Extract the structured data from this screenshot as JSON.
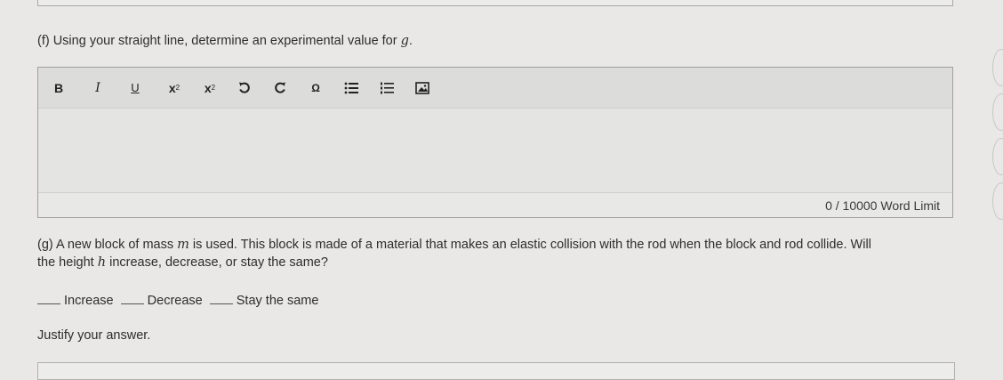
{
  "question_f": {
    "text_before": "(f) Using your straight line, determine an experimental value for ",
    "var": "g",
    "text_after": "."
  },
  "toolbar": {
    "bold": "B",
    "italic": "I",
    "underline": "U",
    "superscript_base": "x",
    "superscript_exp": "2",
    "subscript_base": "x",
    "subscript_index": "2",
    "omega": "Ω"
  },
  "editor": {
    "word_limit": "0 / 10000 Word Limit"
  },
  "question_g": {
    "part1": "(g) A new block of mass ",
    "var_m": "m",
    "part2": " is used. This block is made of a material that makes an elastic collision with the rod when the block and rod collide. Will",
    "part3": "the height ",
    "var_h": "h",
    "part4": " increase, decrease, or stay the same?"
  },
  "choices": {
    "increase": "Increase",
    "decrease": "Decrease",
    "stay": "Stay the same"
  },
  "justify": "Justify your answer."
}
